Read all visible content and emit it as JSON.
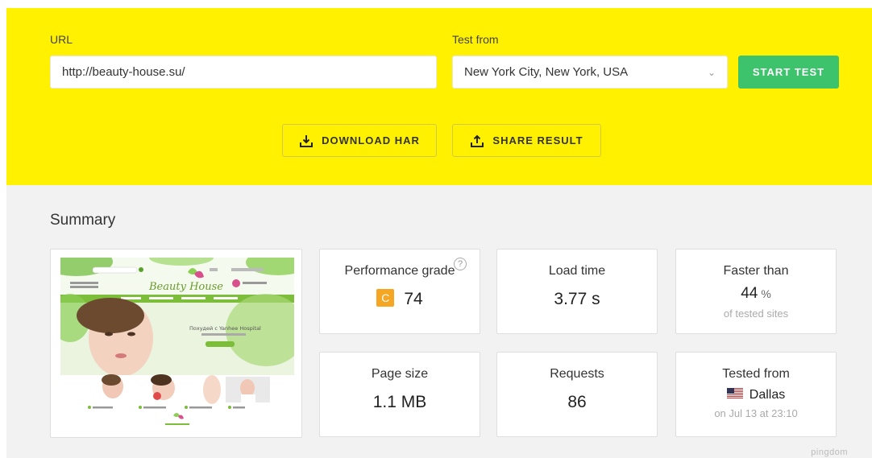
{
  "form": {
    "url_label": "URL",
    "url_value": "http://beauty-house.su/",
    "test_from_label": "Test from",
    "test_from_value": "New York City, New York, USA",
    "start_label": "START TEST",
    "download_label": "DOWNLOAD HAR",
    "share_label": "SHARE RESULT"
  },
  "summary": {
    "title": "Summary",
    "performance": {
      "title": "Performance grade",
      "grade": "C",
      "score": "74",
      "help": "?"
    },
    "load_time": {
      "title": "Load time",
      "value": "3.77 s"
    },
    "faster_than": {
      "title": "Faster than",
      "value": "44",
      "unit": "%",
      "sub": "of tested sites"
    },
    "page_size": {
      "title": "Page size",
      "value": "1.1 MB"
    },
    "requests": {
      "title": "Requests",
      "value": "86"
    },
    "tested_from": {
      "title": "Tested from",
      "value": "Dallas",
      "sub": "on Jul 13 at 23:10",
      "flag_icon": "us-flag-icon"
    }
  },
  "thumbnail": {
    "brand": "Beauty House",
    "banner_text": "Похудей с Yanhee Hospital"
  },
  "footer": {
    "brand": "pingdom"
  },
  "colors": {
    "hero": "#fff100",
    "start": "#3cc36c",
    "grade": "#f5a623"
  }
}
